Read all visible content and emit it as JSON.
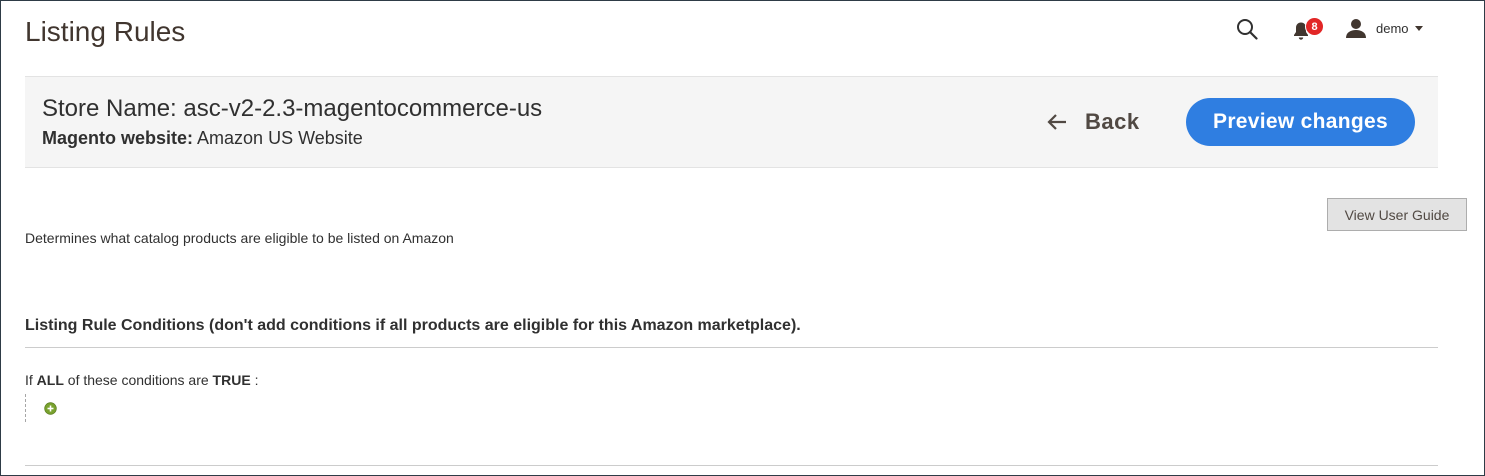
{
  "header": {
    "title": "Listing Rules",
    "notification_count": "8",
    "user_name": "demo"
  },
  "store": {
    "name": "Store Name: asc-v2-2.3-magentocommerce-us",
    "website_label": "Magento website:",
    "website_value": "Amazon US Website",
    "back_label": "Back",
    "preview_label": "Preview changes"
  },
  "guide_button": "View User Guide",
  "description": "Determines what catalog products are eligible to be listed on Amazon",
  "conditions": {
    "section_title": "Listing Rule Conditions (don't add conditions if all products are eligible for this Amazon marketplace).",
    "prefix": "If",
    "aggregator": "ALL",
    "middle": " of these conditions are",
    "value": "TRUE",
    "suffix": ":"
  },
  "colors": {
    "primary_button": "#2f7ee1",
    "badge": "#e22626",
    "add_icon": "#79a22e"
  }
}
